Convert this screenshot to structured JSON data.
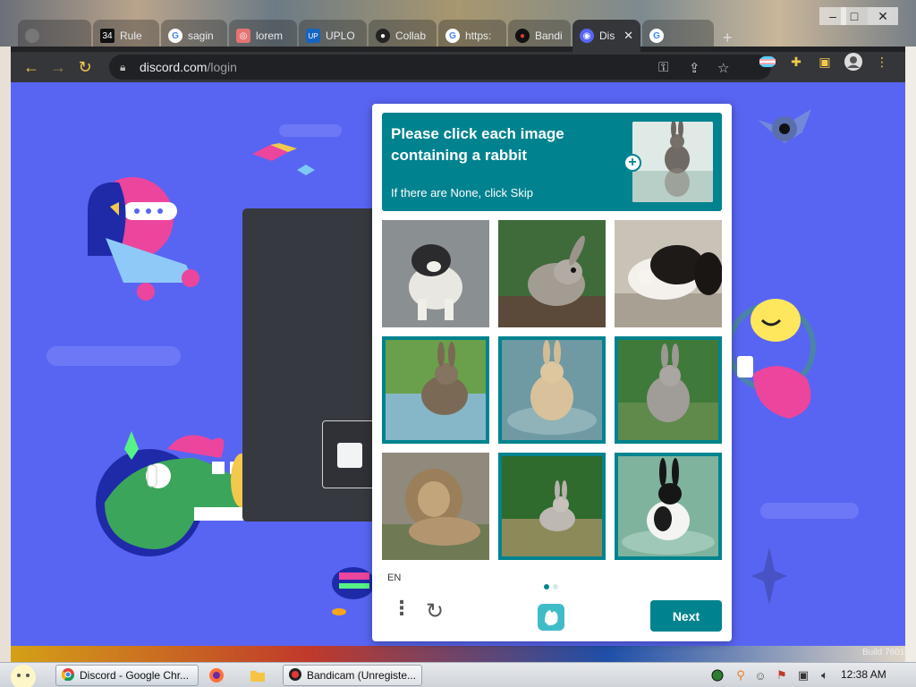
{
  "browser": {
    "tabs": [
      {
        "label": "",
        "favicon": "blank"
      },
      {
        "label": "Rule",
        "favicon": "rule-icon"
      },
      {
        "label": "sagin",
        "favicon": "google-icon"
      },
      {
        "label": "lorem",
        "favicon": "app-icon"
      },
      {
        "label": "UPLO",
        "favicon": "upload-icon"
      },
      {
        "label": "Collab",
        "favicon": "github-icon"
      },
      {
        "label": "https:",
        "favicon": "google-icon"
      },
      {
        "label": "Bandi",
        "favicon": "record-icon"
      },
      {
        "label": "Dis",
        "favicon": "discord-icon"
      },
      {
        "label": "",
        "favicon": "google-icon"
      }
    ],
    "new_tab": "+",
    "window_controls": {
      "minimize": "–",
      "maximize": "□",
      "close": "✕"
    },
    "nav": {
      "back": "←",
      "forward": "→",
      "reload": "↻"
    },
    "url": {
      "host": "discord.com",
      "path": "/login"
    }
  },
  "captcha": {
    "prompt": "Please click each image containing a rabbit",
    "subprompt": "If there are None, click Skip",
    "language": "EN",
    "next_label": "Next",
    "tiles": [
      {
        "subject": "dog",
        "selected": false
      },
      {
        "subject": "rabbit",
        "selected": false
      },
      {
        "subject": "dog",
        "selected": false
      },
      {
        "subject": "rabbit",
        "selected": true
      },
      {
        "subject": "rabbit",
        "selected": true
      },
      {
        "subject": "rabbit",
        "selected": true
      },
      {
        "subject": "lion",
        "selected": false
      },
      {
        "subject": "rabbit",
        "selected": true
      },
      {
        "subject": "rabbit",
        "selected": true
      }
    ],
    "page_dots": 2,
    "active_dot": 1,
    "accent_color": "#00838f"
  },
  "page": {
    "background_color": "#5865f2"
  },
  "taskbar": {
    "items": [
      {
        "label": "Discord - Google Chr...",
        "icon": "chrome-icon"
      },
      {
        "label": "",
        "icon": "firefox-icon"
      },
      {
        "label": "",
        "icon": "folder-icon"
      },
      {
        "label": "Bandicam (Unregiste...",
        "icon": "bandicam-icon"
      }
    ],
    "clock": "12:38 AM",
    "watermark": "Build 7601"
  }
}
